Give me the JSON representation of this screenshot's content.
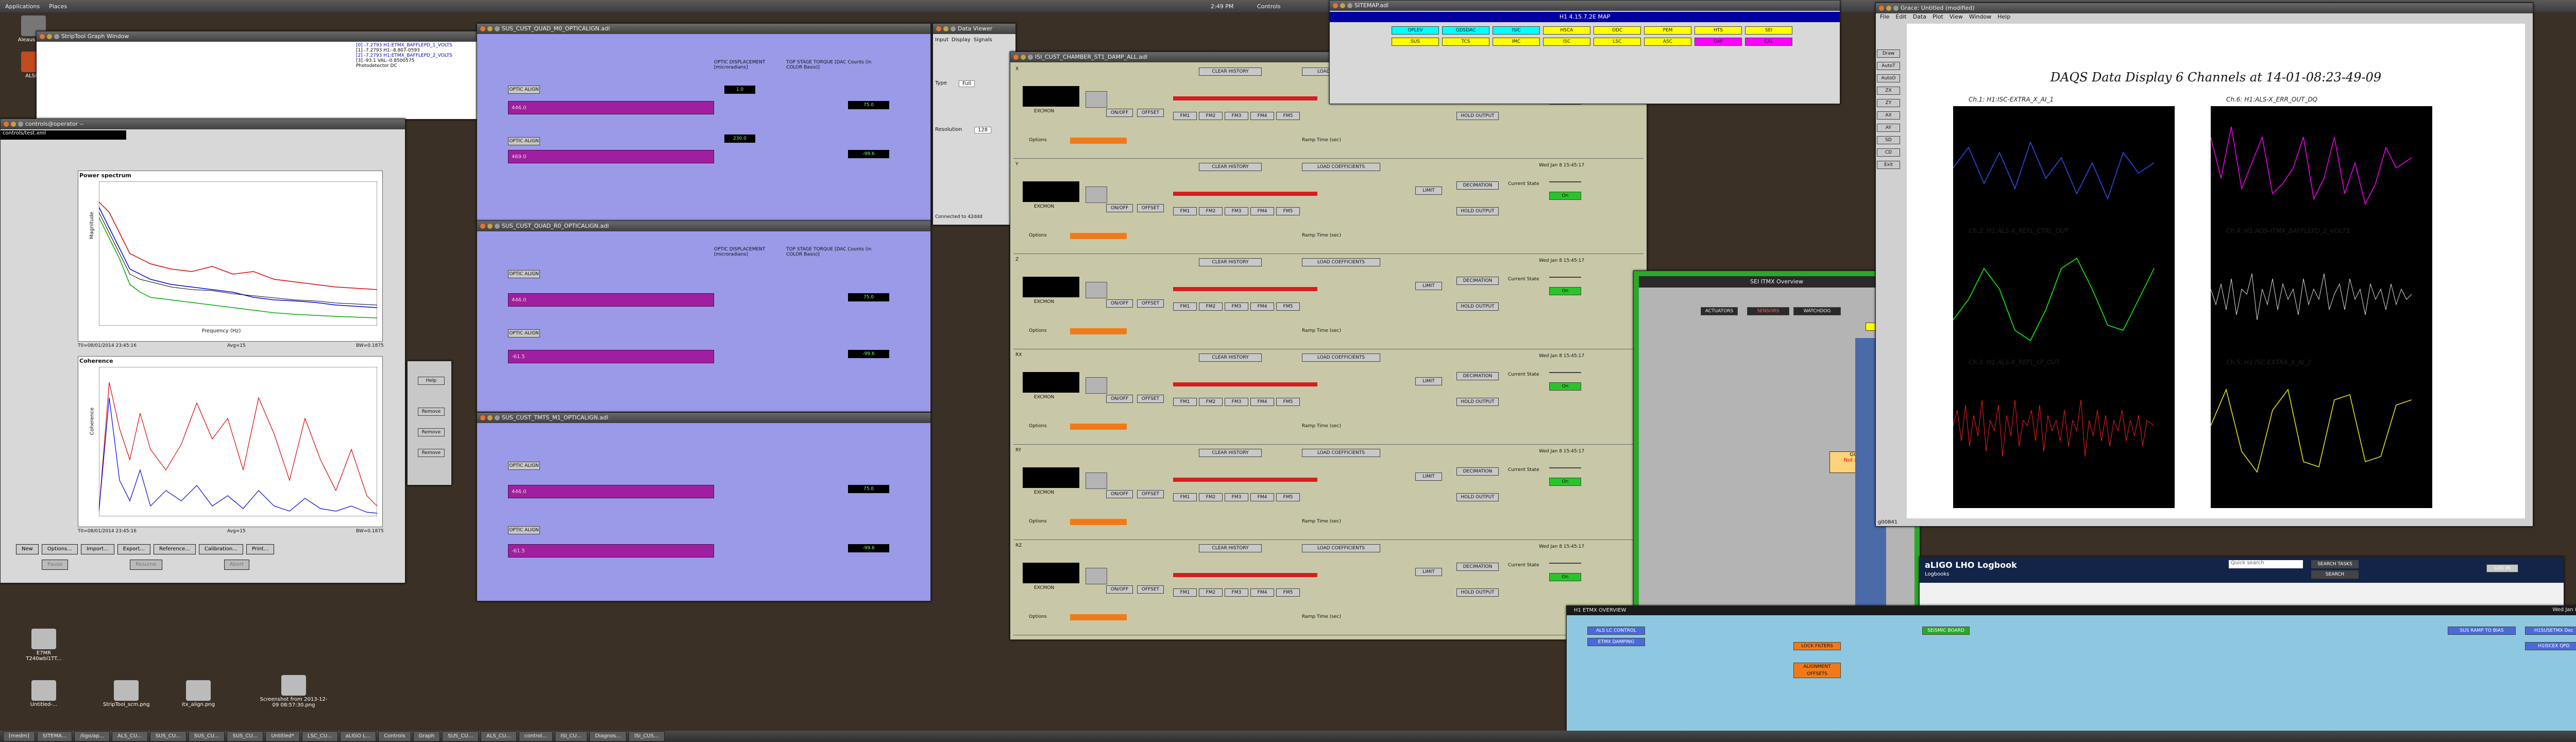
{
  "top_panel": {
    "applications": "Applications",
    "places": "Places",
    "clock": "2:49 PM",
    "user": "Controls"
  },
  "desktop_icons": [
    {
      "label": "Aleaus back"
    },
    {
      "label": "ALSPri"
    },
    {
      "label": "E7MR T240wbl1TT..."
    },
    {
      "label": "Untitled-..."
    },
    {
      "label": "StripTool_scm.png"
    },
    {
      "label": "itx_align.png"
    },
    {
      "label": "Screenshot from 2013-12-09 08:57:30.png"
    }
  ],
  "striptool": {
    "title": "StripTool Graph Window",
    "legend": [
      "[0] -7.2793 H1:ETMX_BAFFLEPD_1_VOLTS",
      "[1] -7.2793 H1:-8.807-0593",
      "[2] -7.2793 H1:ETMX_BAFFLEPD_2_VOLTS",
      "[3] -93.1 VAL:-0.8500575",
      "Photodetector DC"
    ]
  },
  "dtt": {
    "title": "controls@operator --",
    "menu": "controls/test.xml",
    "power_spectrum_title": "Power spectrum",
    "coherence_title": "Coherence",
    "ylabel_top": "Magnitude",
    "ylabel_bottom": "Coherence",
    "xlabel": "Frequency (Hz)",
    "footer_left": "T0=08/01/2014 23:45:16",
    "footer_mid": "Avg=15",
    "footer_right": "BW=0.1875",
    "buttons": [
      "New",
      "Options...",
      "Import...",
      "Export...",
      "Reference...",
      "Calibration...",
      "Print..."
    ],
    "action_buttons": [
      "Pause",
      "Resume",
      "Abort"
    ],
    "side_buttons": [
      "Help",
      "Remove",
      "Remove",
      "Remove"
    ],
    "repeat": "Repeat",
    "fourier": "Fourier Tools",
    "done": "Done"
  },
  "sus_windows": [
    {
      "title": "SUS_CUST_QUAD_M0_OPTICALIGN.adl",
      "rows": [
        "P",
        "Y"
      ]
    },
    {
      "title": "SUS_CUST_QUAD_R0_OPTICALIGN.adl",
      "rows": [
        "P",
        "Y"
      ]
    },
    {
      "title": "SUS_CUST_TMTS_M1_OPTICALIGN.adl",
      "rows": [
        "P",
        "Y"
      ]
    }
  ],
  "sus_labels": {
    "optic_align": "OPTIC ALIGN",
    "offset": "OFFSET",
    "optic_disp": "OPTIC DISPLACEMENT [microradians]",
    "top_stage": "TOP STAGE TORQUE [DAC Counts (in COLOR Basis)]",
    "inmtrx": "INMTRX",
    "values": [
      "446.0",
      "75.0",
      "469.0",
      "-61.5",
      "1.0",
      "230.0",
      "-99.6"
    ]
  },
  "data_viewer": {
    "title": "Data Viewer",
    "tabs": [
      "Input",
      "Display",
      "Signals"
    ],
    "type_label": "Type",
    "type_value": "Full",
    "resolution_label": "Resolution",
    "resolution_value": "128",
    "connected": "Connected to 42ddd"
  },
  "sus_damp": {
    "title": "ISI_CUST_CHAMBER_ST1_DAMP_ALL.adl",
    "rows": [
      "X",
      "Y",
      "Z",
      "RX",
      "RY",
      "RZ"
    ],
    "clear_history": "CLEAR HISTORY",
    "load_coeff": "LOAD COEFFICIENTS",
    "filters": [
      "FM1",
      "FM2",
      "FM3",
      "FM4",
      "FM5"
    ],
    "excmon": "EXCMON",
    "on_off": "ON/OFF",
    "offset": "OFFSET",
    "limit": "LIMIT",
    "decimation": "DECIMATION",
    "hold_output": "HOLD OUTPUT",
    "current_state": "Current State",
    "subomos": "Subomos",
    "ramp_time": "Ramp Time (sec)",
    "options": "Options",
    "time": "Wed Jan  8 15:45:17",
    "status": "On",
    "output": "OUTPUT"
  },
  "sitemap": {
    "title": "SITEMAP.adl",
    "header": "H1 4.15.7.2E MAP",
    "buttons": [
      "OPLEV",
      "GDSDAC",
      "ISIC",
      "HSCA",
      "ODC",
      "PEM",
      "HTS",
      "SEI",
      "SUS",
      "TCS",
      "IMC",
      "ISC",
      "LSC",
      "ASC",
      "OAF",
      "CAL"
    ]
  },
  "grace": {
    "title": "Grace: Untitled (modified)",
    "menu": [
      "File",
      "Edit",
      "Data",
      "Plot",
      "View",
      "Window",
      "Help"
    ],
    "chart_title": "DAQS Data Display 6 Channels at 14-01-08:23-49-09",
    "panel_titles": [
      "Ch.1: H1:ISC-EXTRA_X_AI_1",
      "Ch.6: H1:ALS-X_ERR_OUT_DQ",
      "Ch.2: H1:ALS-X_REFL_CTRL_OUT",
      "Ch.4: H1:AOS-ITMX_BAFFLEPD_2_VOLTS",
      "Ch.3: H1:ALS-X_REFL_LF_OUT",
      "Ch.5: H1:ISC-EXTRA_X_AI_2"
    ],
    "tool_buttons": [
      "Draw",
      "AutoT",
      "AutoO",
      "ZX",
      "ZY",
      "AX",
      "AY",
      "SD",
      "CD",
      "Exit"
    ],
    "status": "g00841"
  },
  "logbook": {
    "title": "aLIGO LHO Logbook",
    "subtitle": "Logbooks",
    "search_tasks": "SEARCH TASKS",
    "search": "SEARCH",
    "quick_search": "Quick search",
    "login": "LOG IN"
  },
  "mc_screen": {
    "title": "H1 ETMX OVERVIEW",
    "time": "Wed Jan  8 15:45:17 2014",
    "buttons": [
      "ALS LC CONTROL",
      "ETMX DAMPING",
      "SEISMIC BOARD",
      "SUS RAMP TO BIAS",
      "H1SUSETMX Dec",
      "H1ISCEX QPD"
    ],
    "relabels": [
      "ALIGNMENT OFFSETS",
      "LOCK FILTERS",
      "MAIN"
    ]
  },
  "isi_screen": {
    "title": "SEI ITMX Overview",
    "actuators": [
      "ACTUATORS",
      "SENSORS",
      "WATCHDOG",
      "MASTER SWITCH"
    ],
    "status": "Not in progress",
    "group": "GUARDIAN",
    "green": "OPTIMIZE"
  },
  "taskbar": [
    "[medm]",
    "SITEMA...",
    "/ligo/ap...",
    "ALS_CU...",
    "SUS_CU...",
    "SUS_CU...",
    "SUS_CU...",
    "Untitled*",
    "LSC_CU...",
    "aLIGO L...",
    "Controls",
    "Graph",
    "SUS_CU...",
    "ALS_CU...",
    "control...",
    "ISI_CU...",
    "Diagnos...",
    "ISI_CUS..."
  ]
}
